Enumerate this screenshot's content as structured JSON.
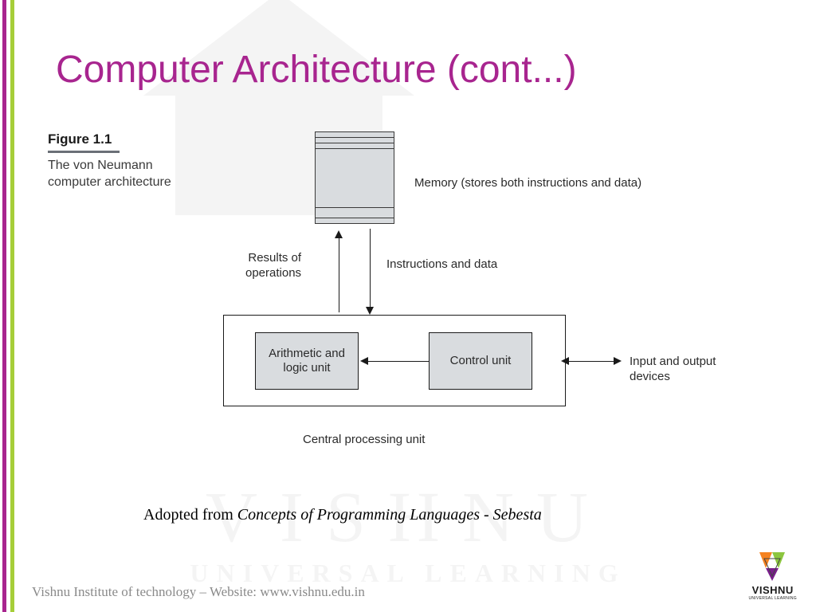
{
  "title": "Computer Architecture (cont...)",
  "figure": {
    "label": "Figure 1.1",
    "caption": "The von Neumann computer architecture"
  },
  "diagram": {
    "memory_label": "Memory (stores both instructions and data)",
    "results_label": "Results of\noperations",
    "instr_label": "Instructions and data",
    "alu_label": "Arithmetic and logic unit",
    "cu_label": "Control unit",
    "io_label": "Input and output devices",
    "cpu_label": "Central processing unit"
  },
  "source": {
    "prefix": "Adopted from ",
    "work": "Concepts of Programming Languages - Sebesta"
  },
  "footer": "Vishnu Institute of technology – Website: www.vishnu.edu.in",
  "watermark": {
    "line1": "VISHNU",
    "line2": "UNIVERSAL LEARNING"
  },
  "brand": {
    "name": "VISHNU",
    "tagline": "UNIVERSAL LEARNING"
  }
}
